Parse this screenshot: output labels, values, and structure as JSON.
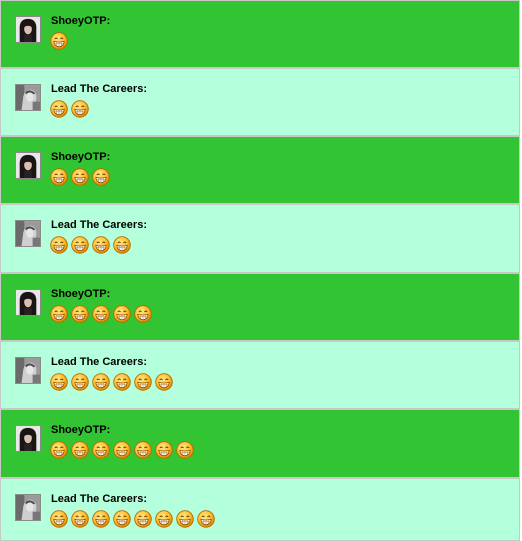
{
  "messages": [
    {
      "sender": "ShoeyOTP:",
      "avatar": "user-avatar-shoeyotp",
      "emotes": [
        "grin-emoticon"
      ]
    },
    {
      "sender": "Lead The Careers:",
      "avatar": "user-avatar-lead-the-careers",
      "emotes": [
        "grin-emoticon",
        "grin-emoticon"
      ]
    },
    {
      "sender": "ShoeyOTP:",
      "avatar": "user-avatar-shoeyotp",
      "emotes": [
        "grin-emoticon",
        "grin-emoticon",
        "grin-emoticon"
      ]
    },
    {
      "sender": "Lead The Careers:",
      "avatar": "user-avatar-lead-the-careers",
      "emotes": [
        "grin-emoticon",
        "grin-emoticon",
        "grin-emoticon",
        "grin-emoticon"
      ]
    },
    {
      "sender": "ShoeyOTP:",
      "avatar": "user-avatar-shoeyotp",
      "emotes": [
        "grin-emoticon",
        "grin-emoticon",
        "grin-emoticon",
        "grin-emoticon",
        "grin-emoticon"
      ]
    },
    {
      "sender": "Lead The Careers:",
      "avatar": "user-avatar-lead-the-careers",
      "emotes": [
        "grin-emoticon",
        "grin-emoticon",
        "grin-emoticon",
        "grin-emoticon",
        "grin-emoticon",
        "grin-emoticon"
      ]
    },
    {
      "sender": "ShoeyOTP:",
      "avatar": "user-avatar-shoeyotp",
      "emotes": [
        "grin-emoticon",
        "grin-emoticon",
        "grin-emoticon",
        "grin-emoticon",
        "grin-emoticon",
        "grin-emoticon",
        "grin-emoticon"
      ]
    },
    {
      "sender": "Lead The Careers:",
      "avatar": "user-avatar-lead-the-careers",
      "emotes": [
        "grin-emoticon",
        "grin-emoticon",
        "grin-emoticon",
        "grin-emoticon",
        "grin-emoticon",
        "grin-emoticon",
        "grin-emoticon",
        "grin-emoticon"
      ]
    }
  ],
  "colors": {
    "shoeyotp_row": "#33c433",
    "lead_row": "#b4ffdc"
  }
}
